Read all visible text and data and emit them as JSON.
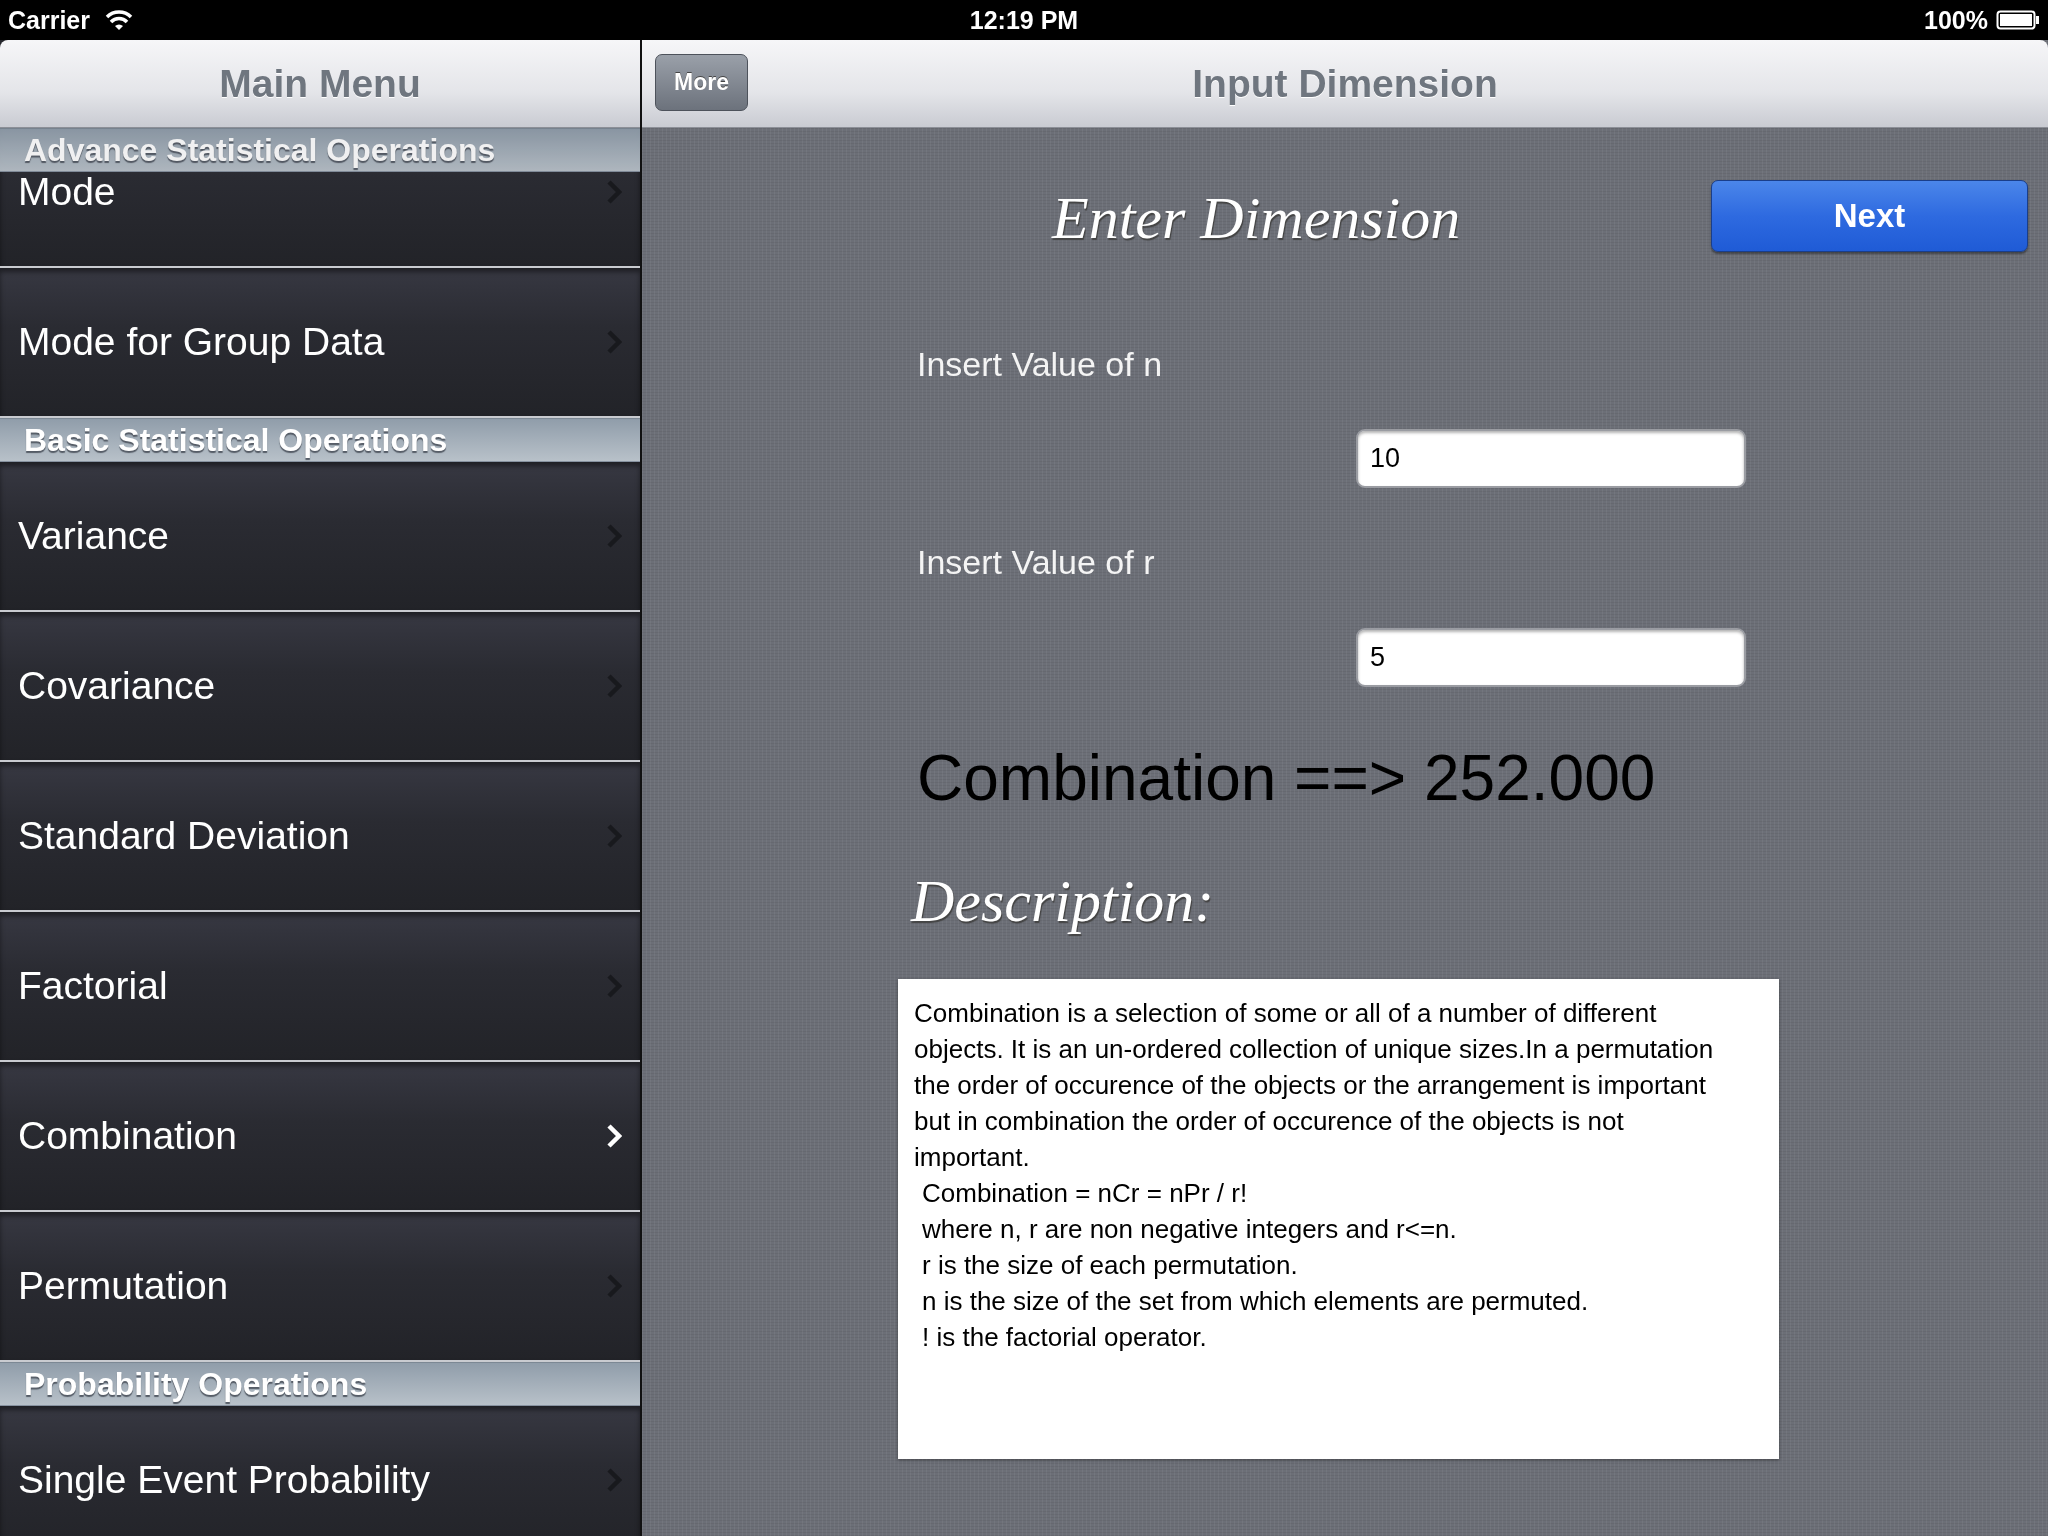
{
  "status_bar": {
    "carrier": "Carrier",
    "time": "12:19 PM",
    "battery": "100%"
  },
  "sidebar": {
    "title": "Main Menu",
    "sections": [
      {
        "header": "Advance Statistical Operations",
        "items": [
          {
            "label": "Mode",
            "selected": false
          },
          {
            "label": "Mode for Group Data",
            "selected": false
          }
        ]
      },
      {
        "header": "Basic Statistical Operations",
        "items": [
          {
            "label": "Variance",
            "selected": false
          },
          {
            "label": "Covariance",
            "selected": false
          },
          {
            "label": "Standard Deviation",
            "selected": false
          },
          {
            "label": "Factorial",
            "selected": false
          },
          {
            "label": "Combination",
            "selected": true
          },
          {
            "label": "Permutation",
            "selected": false
          }
        ]
      },
      {
        "header": "Probability Operations",
        "items": [
          {
            "label": "Single Event Probability",
            "selected": false
          }
        ]
      }
    ]
  },
  "detail": {
    "title": "Input Dimension",
    "back_button": "More",
    "heading": "Enter Dimension",
    "next_button": "Next",
    "fields": [
      {
        "label": "Insert Value of n",
        "value": "10"
      },
      {
        "label": "Insert Value of r",
        "value": "5"
      }
    ],
    "result": "Combination ==> 252.000",
    "description_heading": "Description:",
    "description": {
      "paragraph": "Combination is a selection of some or all of a number of different objects. It is an un-ordered collection of unique sizes.In a permutation the order of occurence of the objects or the arrangement is important but in combination the order of occurence of the objects is not important.",
      "lines": [
        "Combination = nCr = nPr / r!",
        "where  n, r are non negative integers and r<=n.",
        "r is the size of each permutation.",
        "n is the size of the set from which elements are permuted.",
        "! is the factorial operator."
      ]
    }
  }
}
